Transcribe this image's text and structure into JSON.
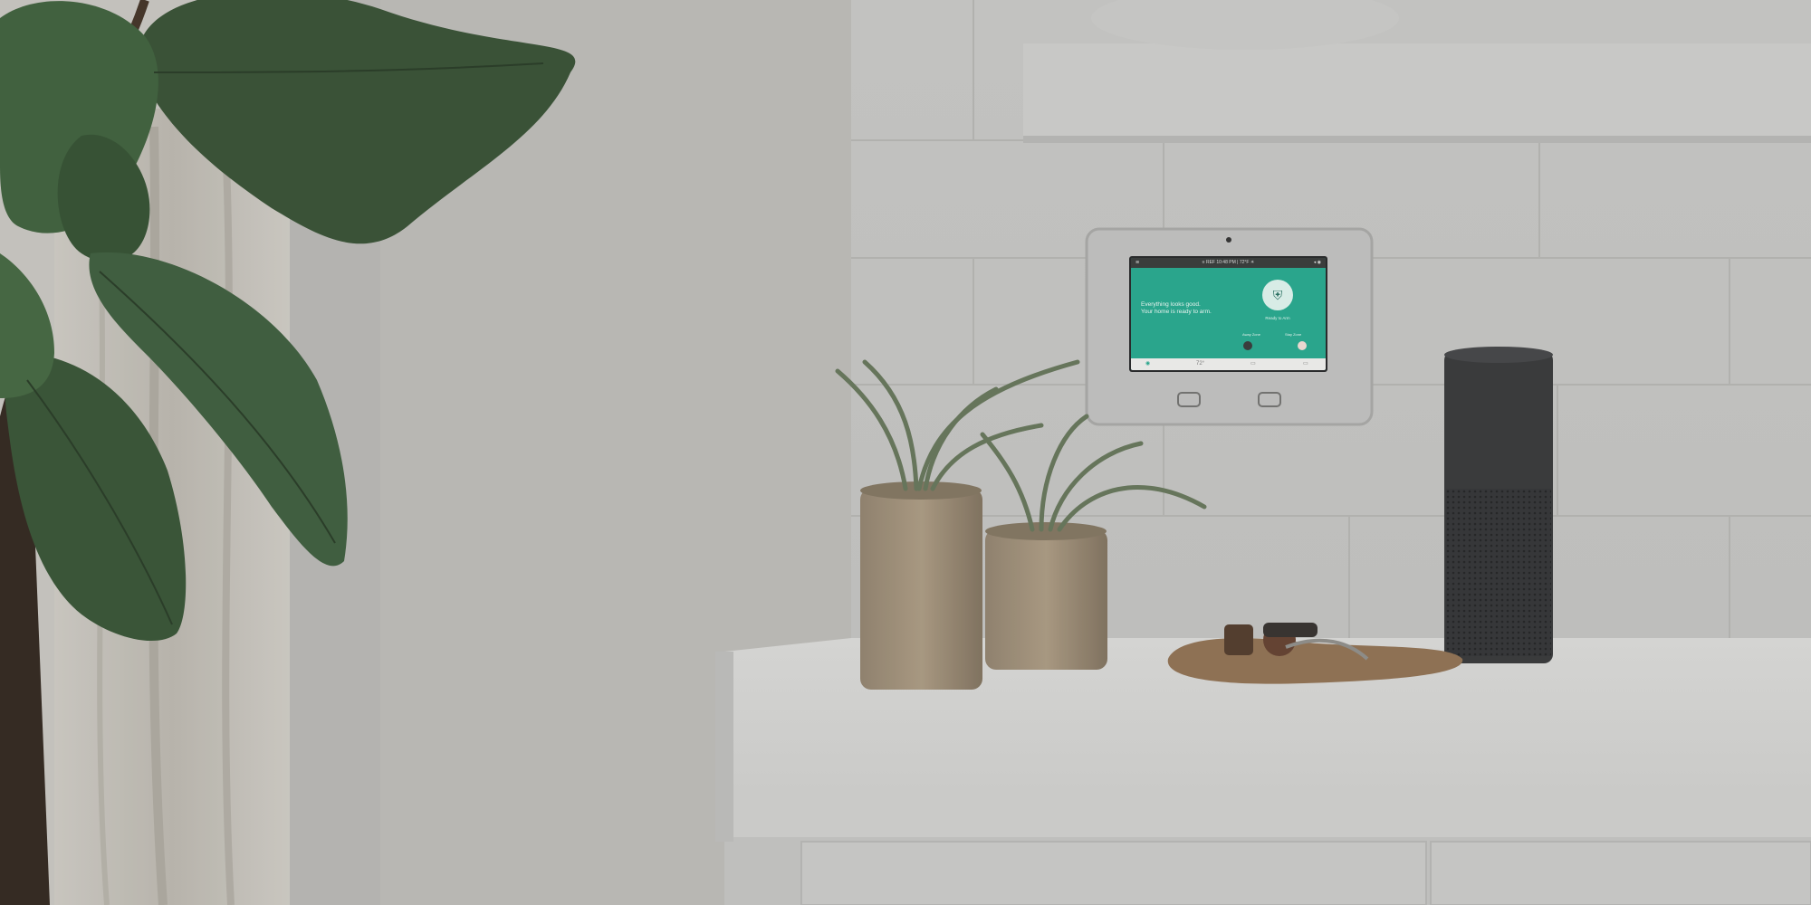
{
  "panel": {
    "status_bar": "≡ REF  10:48 PM  |  72°F ☀",
    "message_line1": "Everything looks good.",
    "message_line2": "Your home is ready to arm.",
    "ready_label": "Ready to Arm",
    "mode_left": "Away Zone",
    "mode_right": "Stay Zone",
    "nav_temp": "72°"
  },
  "colors": {
    "screen_accent": "#2aa58c",
    "wall": "#d6d5d0",
    "counter": "#e7e7e5"
  }
}
